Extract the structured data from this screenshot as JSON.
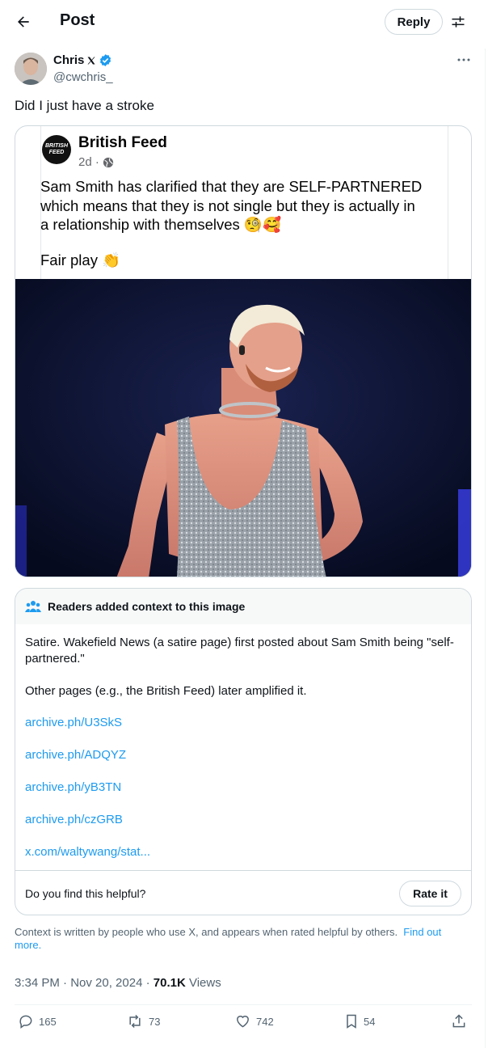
{
  "header": {
    "back_icon": "arrow-left-icon",
    "title": "Post",
    "reply_label": "Reply",
    "filter_icon": "sliders-icon"
  },
  "author": {
    "name": "Chris",
    "handle": "@cwchris_",
    "verified_color": "#1d9bf0",
    "x_badge_icon": "x-logo-icon",
    "more_icon": "more-horizontal-icon"
  },
  "post": {
    "text": "Did I just have a stroke"
  },
  "embedded_post": {
    "logo_text": "BRITISH FEED",
    "page_name": "British Feed",
    "age": "2d ·",
    "globe_icon": "globe-icon",
    "body_line1": "Sam Smith has clarified that they are SELF-PARTNERED",
    "body_line2": "which means that they is not single but they is actually in",
    "body_line3": "a relationship with themselves 🧐🥰",
    "body_line4": "Fair play 👏"
  },
  "community_note": {
    "header": "Readers added context to this image",
    "header_icon": "people-icon",
    "paragraph1": "Satire. Wakefield News (a satire page) first posted about Sam Smith being \"self-partnered.\"",
    "paragraph2": "Other pages (e.g., the British Feed) later amplified it.",
    "links": [
      "archive.ph/U3SkS",
      "archive.ph/ADQYZ",
      "archive.ph/yB3TN",
      "archive.ph/czGRB",
      "x.com/waltywang/stat..."
    ],
    "helpful_question": "Do you find this helpful?",
    "rate_label": "Rate it",
    "footer_text": "Context is written by people who use X, and appears when rated helpful by others.",
    "footer_link": "Find out more."
  },
  "meta": {
    "time_date": "3:34 PM · Nov 20, 2024 · ",
    "views_count": "70.1K",
    "views_label": " Views"
  },
  "actions": {
    "replies": "165",
    "reposts": "73",
    "likes": "742",
    "bookmarks": "54",
    "share_icon": "share-icon"
  },
  "colors": {
    "link": "#1d9bf0",
    "text": "#0f1419",
    "muted": "#536471",
    "border": "#cfd9de"
  }
}
